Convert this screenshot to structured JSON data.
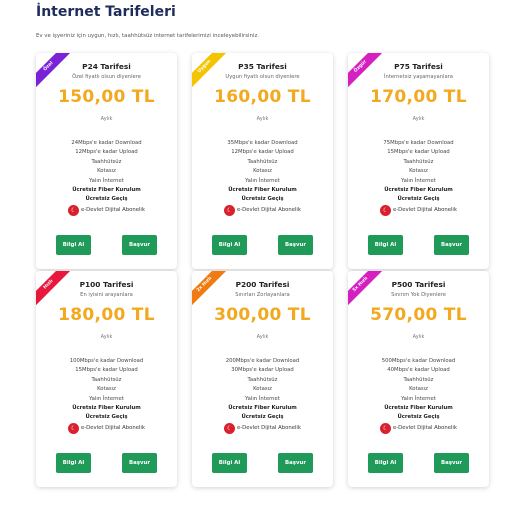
{
  "header": {
    "title": "İnternet Tarifeleri",
    "subtitle": "Ev ve işyeriniz için uygun, hızlı, taahhütsüz internet tarifelerimizi inceleyebilirsiniz."
  },
  "common": {
    "period": "Aylık",
    "info_button": "Bilgi Al",
    "apply_button": "Başvur",
    "devlet_label": "e-Devlet Dijital Abonelik"
  },
  "colors": {
    "accent_price": "#f2a91f",
    "button_green": "#1f9a59",
    "title_navy": "#1f2d5a"
  },
  "plans": [
    {
      "badge": "Özel",
      "badge_color": "#7a22d8",
      "name": "P24 Tarifesi",
      "desc": "Özel fiyatlı olsun diyenlere",
      "price": "150,00 TL",
      "features": [
        "24Mbps'e kadar Download",
        "12Mbps'e kadar Upload",
        "Taahhütsüz",
        "Kotasız",
        "Yalın İnternet",
        "Ücretsiz Fiber Kurulum",
        "Ücretsiz Geçiş"
      ]
    },
    {
      "badge": "Uygun",
      "badge_color": "#f5c400",
      "name": "P35 Tarifesi",
      "desc": "Uygun fiyatlı olsun diyenlere",
      "price": "160,00 TL",
      "features": [
        "35Mbps'e kadar Download",
        "12Mbps'e kadar Upload",
        "Taahhütsüz",
        "Kotasız",
        "Yalın İnternet",
        "Ücretsiz Fiber Kurulum",
        "Ücretsiz Geçiş"
      ]
    },
    {
      "badge": "Özgür",
      "badge_color": "#d61fc1",
      "name": "P75 Tarifesi",
      "desc": "İnternetsiz yaşamayanlara",
      "price": "170,00 TL",
      "features": [
        "75Mbps'e kadar Download",
        "15Mbps'e kadar Upload",
        "Taahhütsüz",
        "Kotasız",
        "Yalın İnternet",
        "Ücretsiz Fiber Kurulum",
        "Ücretsiz Geçiş"
      ]
    },
    {
      "badge": "Hızlı",
      "badge_color": "#e8183c",
      "name": "P100 Tarifesi",
      "desc": "En iyisini arayanlara",
      "price": "180,00 TL",
      "features": [
        "100Mbps'e kadar Download",
        "15Mbps'e kadar Upload",
        "Taahhütsüz",
        "Kotasız",
        "Yalın İnternet",
        "Ücretsiz Fiber Kurulum",
        "Ücretsiz Geçiş"
      ]
    },
    {
      "badge": "2x Hızlı",
      "badge_color": "#f07b12",
      "name": "P200 Tarifesi",
      "desc": "Sınırları Zorlayanlara",
      "price": "300,00 TL",
      "features": [
        "200Mbps'e kadar Download",
        "30Mbps'e kadar Upload",
        "Taahhütsüz",
        "Kotasız",
        "Yalın İnternet",
        "Ücretsiz Fiber Kurulum",
        "Ücretsiz Geçiş"
      ]
    },
    {
      "badge": "5x Hızlı",
      "badge_color": "#d61fc1",
      "name": "P500 Tarifesi",
      "desc": "Sınırım Yok Diyenlere",
      "price": "570,00 TL",
      "features": [
        "500Mbps'e kadar Download",
        "40Mbps'e kadar Upload",
        "Taahhütsüz",
        "Kotasız",
        "Yalın İnternet",
        "Ücretsiz Fiber Kurulum",
        "Ücretsiz Geçiş"
      ]
    }
  ]
}
